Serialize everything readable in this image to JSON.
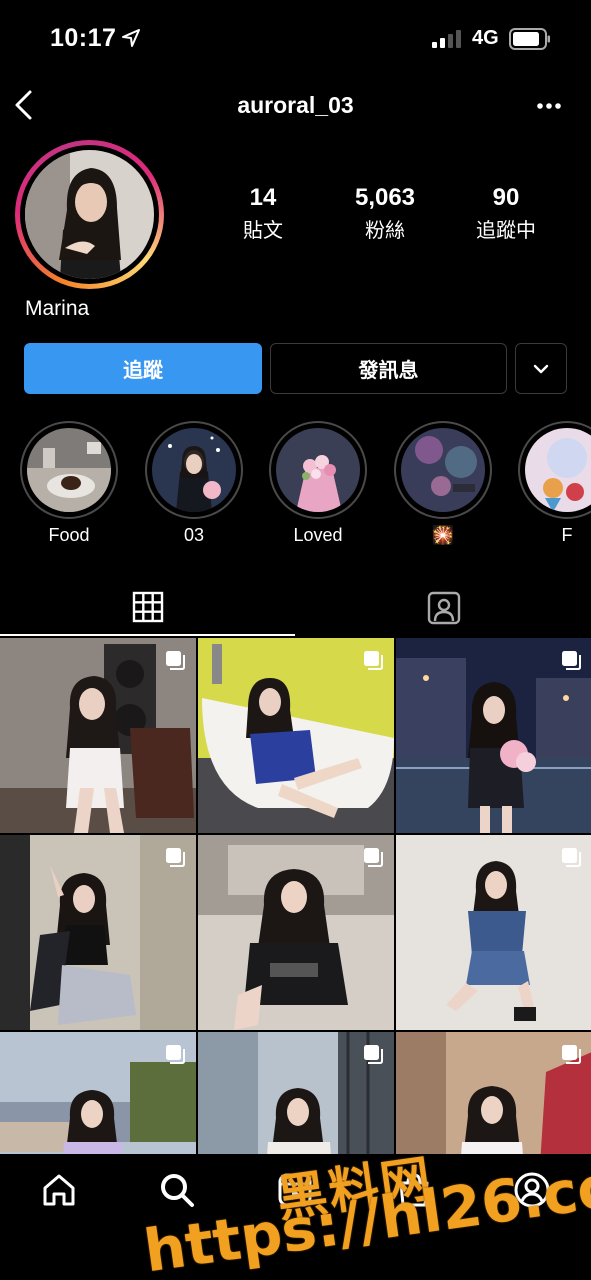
{
  "status_bar": {
    "time": "10:17",
    "network": "4G"
  },
  "header": {
    "username": "auroral_03"
  },
  "profile": {
    "display_name": "Marina",
    "stats": [
      {
        "value": "14",
        "label": "貼文"
      },
      {
        "value": "5,063",
        "label": "粉絲"
      },
      {
        "value": "90",
        "label": "追蹤中"
      }
    ]
  },
  "actions": {
    "follow_label": "追蹤",
    "message_label": "發訊息"
  },
  "highlights": [
    {
      "label": "Food"
    },
    {
      "label": "03"
    },
    {
      "label": "Loved"
    },
    {
      "label": "🎇"
    },
    {
      "label": "F"
    }
  ],
  "watermark": {
    "line1": "黑料网",
    "line2": "https://hl26.co"
  },
  "colors": {
    "accent": "#3897f0",
    "background": "#000000",
    "watermark": "#f1a020"
  },
  "icons": [
    "location-arrow-icon",
    "signal-icon",
    "battery-icon",
    "back-icon",
    "more-icon",
    "chevron-down-icon",
    "grid-icon",
    "tagged-icon",
    "multi-photo-icon",
    "home-icon",
    "search-icon",
    "reels-icon",
    "shop-icon",
    "profile-icon"
  ]
}
